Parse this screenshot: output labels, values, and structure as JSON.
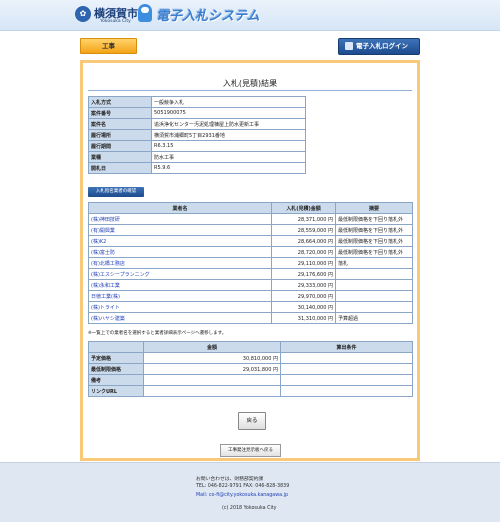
{
  "header": {
    "city_name": "横須賀市",
    "city_name_en": "Yokosuka City",
    "system_title": "電子入札システム",
    "seal_glyph": "✿"
  },
  "nav": {
    "category_tab": "工事",
    "login_button": "電子入札ログイン"
  },
  "page": {
    "title": "入札(見積)結果"
  },
  "info": [
    {
      "label": "入札方式",
      "value": "一般競争入札"
    },
    {
      "label": "案件番号",
      "value": "5051900075"
    },
    {
      "label": "案件名",
      "value": "追浜浄化センター汚泥処理棟屋上防水更新工事"
    },
    {
      "label": "履行場所",
      "value": "横須賀市浦郷町5丁目2931番地"
    },
    {
      "label": "履行期間",
      "value": "R6.3.15"
    },
    {
      "label": "業種",
      "value": "防水工事"
    },
    {
      "label": "開札日",
      "value": "R5.9.6"
    }
  ],
  "bidder_link_button": "入札指名業者の確認",
  "results": {
    "headers": [
      "業者名",
      "入札(見積)金額",
      "摘要"
    ],
    "rows": [
      {
        "name": "(株)神田技研",
        "amount": "28,371,000 円",
        "note": "最低制限価格を下回り落札外"
      },
      {
        "name": "(有)開興業",
        "amount": "28,559,000 円",
        "note": "最低制限価格を下回り落札外"
      },
      {
        "name": "(株)K2",
        "amount": "28,664,000 円",
        "note": "最低制限価格を下回り落札外"
      },
      {
        "name": "(株)富士防",
        "amount": "28,720,000 円",
        "note": "最低制限価格を下回り落札外"
      },
      {
        "name": "(有)北橋工務店",
        "amount": "29,110,000 円",
        "note": "落札"
      },
      {
        "name": "(株)エスシープランニング",
        "amount": "29,176,600 円",
        "note": ""
      },
      {
        "name": "(株)永和工業",
        "amount": "29,333,000 円",
        "note": ""
      },
      {
        "name": "日徳工業(株)",
        "amount": "29,970,000 円",
        "note": ""
      },
      {
        "name": "(株)トライト",
        "amount": "30,140,000 円",
        "note": ""
      },
      {
        "name": "(株)ハヤシ建築",
        "amount": "31,310,000 円",
        "note": "予算超過"
      }
    ]
  },
  "results_note": "※一覧上での業者名を選択すると業者詳細表示ページへ遷移します。",
  "prices": {
    "headers": [
      "",
      "金額",
      "算出条件"
    ],
    "rows": [
      {
        "label": "予定価格",
        "amount": "30,810,000 円",
        "condition": ""
      },
      {
        "label": "最低制限価格",
        "amount": "29,031,800 円",
        "condition": ""
      },
      {
        "label": "備考",
        "amount": "",
        "condition": ""
      },
      {
        "label": "リンクURL",
        "amount": "",
        "condition": ""
      }
    ]
  },
  "back_button": "戻る",
  "return_list_button": "工事発注見示板へ戻る",
  "footer": {
    "contact": "お問い合わせは、財務部契約課",
    "phone": "TEL: 046-822-9791 FAX: 046-828-3839",
    "mail": "Mail: co-fi@city.yokosuka.kanagawa.jp",
    "copyright": "(c) 2018 Yokosuka City"
  }
}
